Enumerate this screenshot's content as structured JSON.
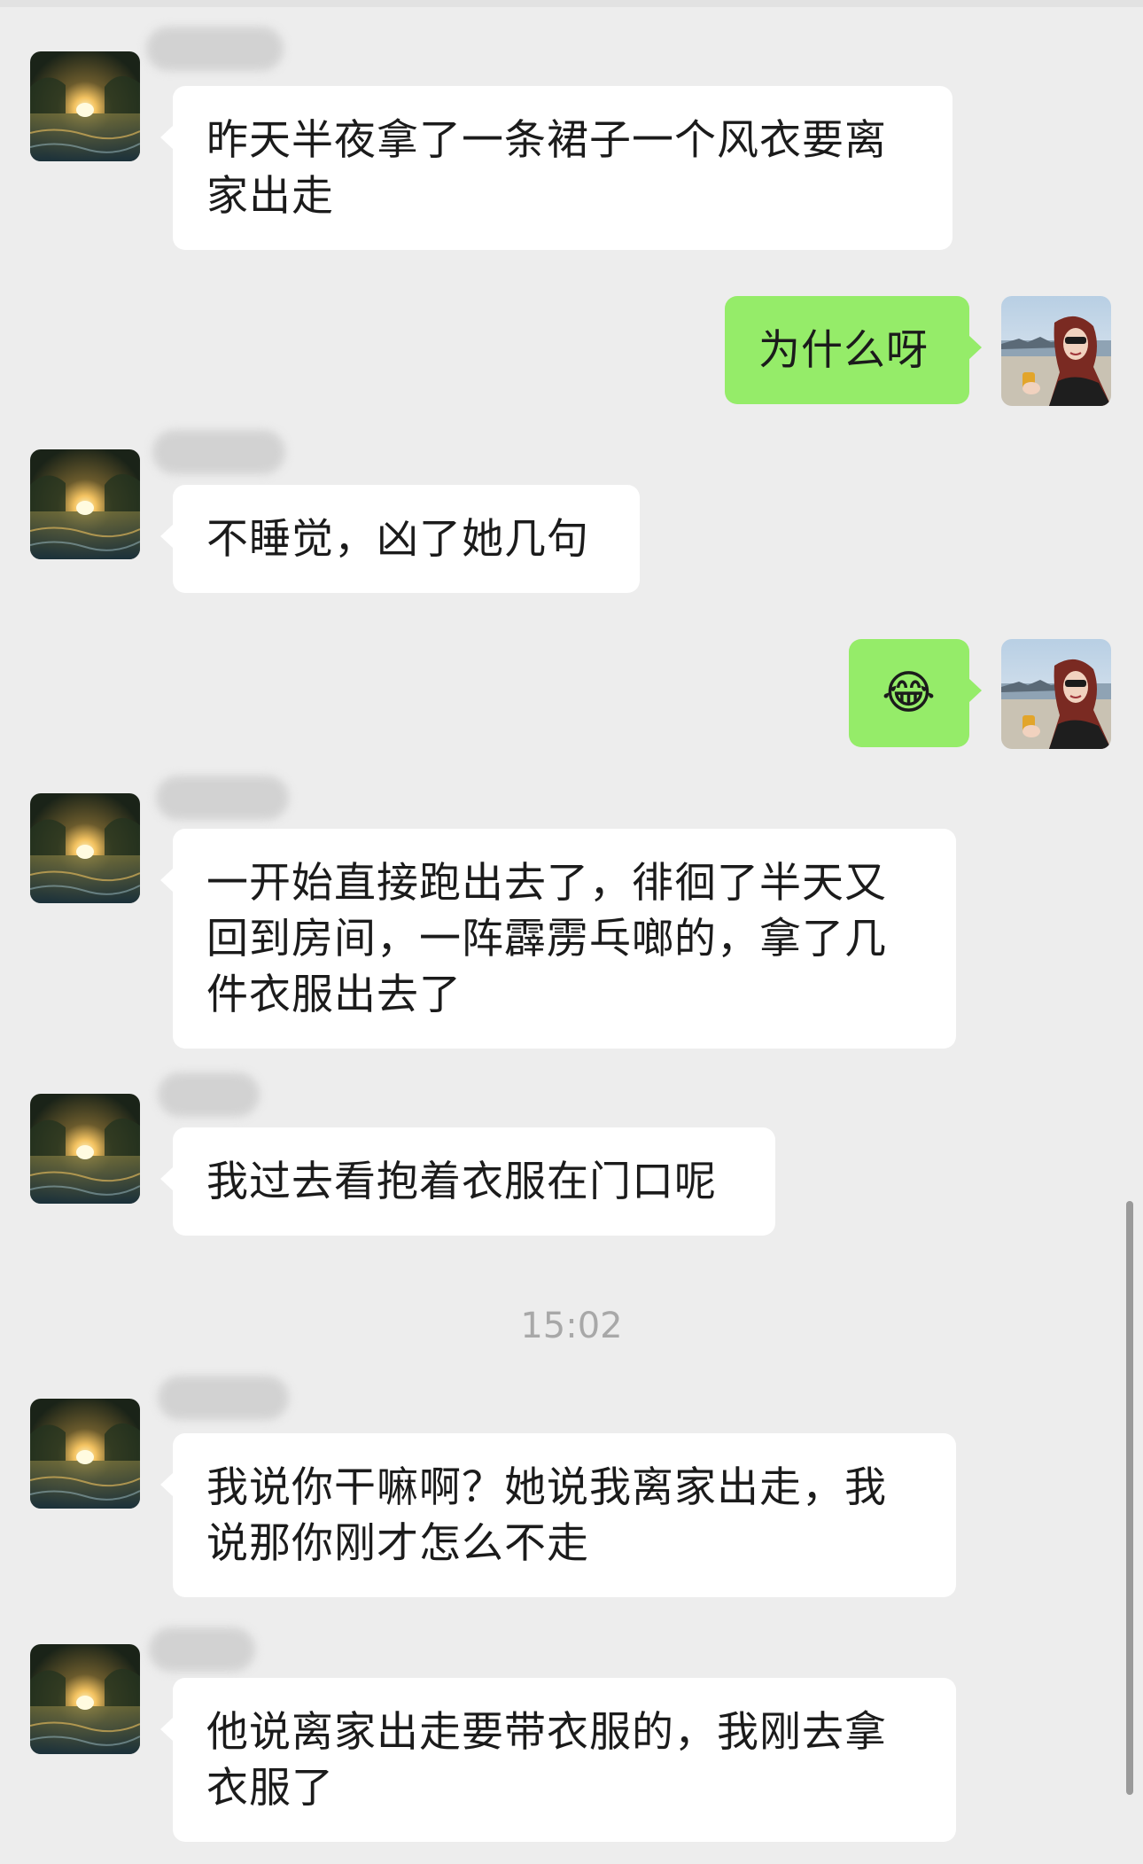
{
  "conversation": {
    "timestamp": "15:02",
    "messages": [
      {
        "side": "in",
        "text": "昨天半夜拿了一条裙子一个风衣要离家出走"
      },
      {
        "side": "out",
        "text": "为什么呀"
      },
      {
        "side": "in",
        "text": "不睡觉，凶了她几句"
      },
      {
        "side": "out",
        "text": "😂"
      },
      {
        "side": "in",
        "text": "一开始直接跑出去了，徘徊了半天又回到房间，一阵霹雳乓啷的，拿了几件衣服出去了"
      },
      {
        "side": "in",
        "text": "我过去看抱着衣服在门口呢"
      },
      {
        "side": "in",
        "text": "我说你干嘛啊？她说我离家出走，我说那你刚才怎么不走"
      },
      {
        "side": "in",
        "text": "他说离家出走要带衣服的，我刚去拿衣服了"
      }
    ]
  },
  "colors": {
    "background": "#ededed",
    "incoming_bubble": "#ffffff",
    "outgoing_bubble": "#95ec69"
  },
  "icons": {
    "incoming_avatar": "sunset-river-avatar",
    "outgoing_avatar": "woman-sunglasses-avatar"
  }
}
